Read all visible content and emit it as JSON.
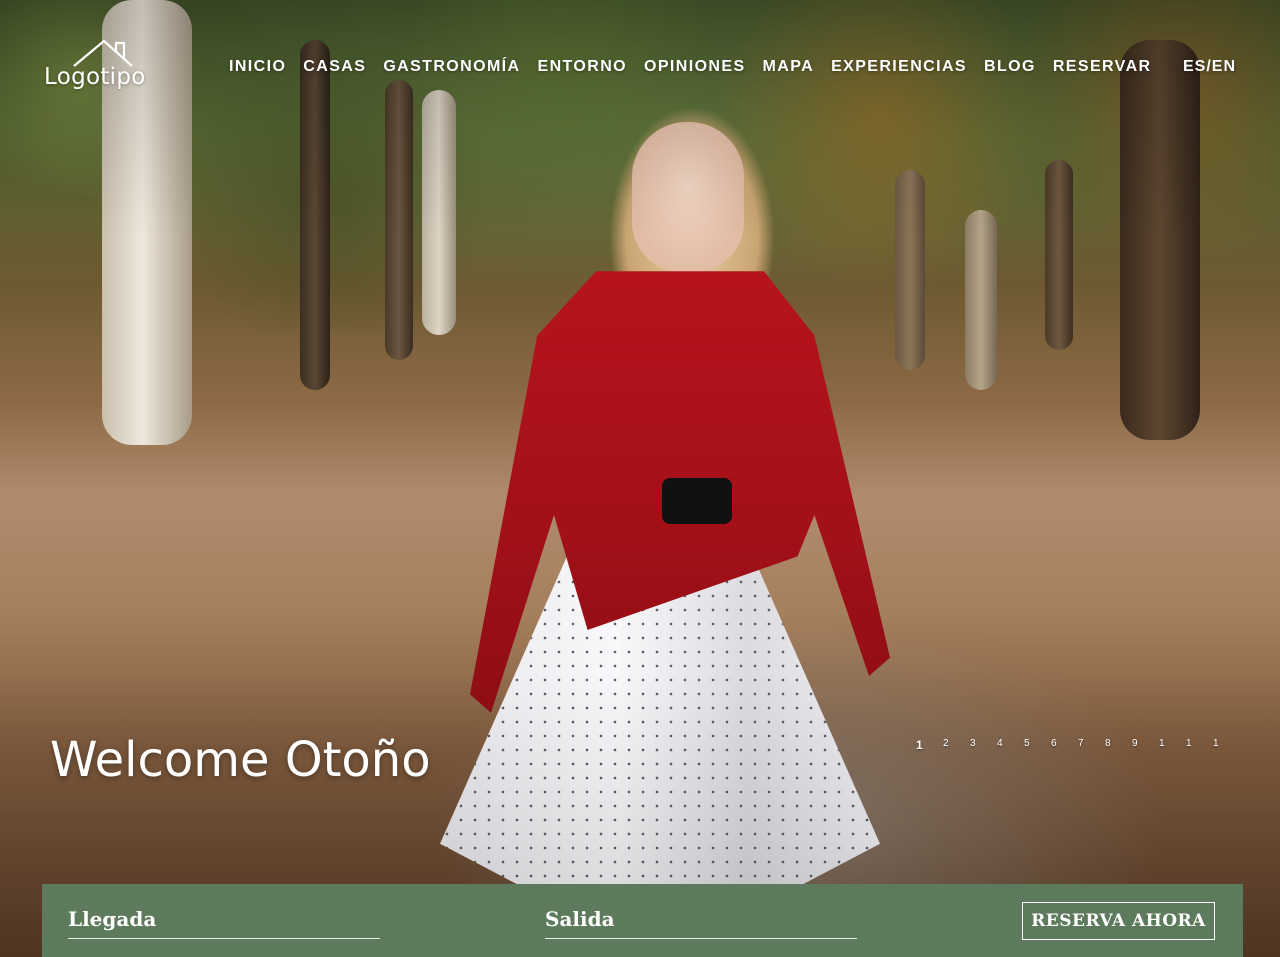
{
  "logo": {
    "text": "Logotipo",
    "icon": "house-roof-icon"
  },
  "nav": {
    "items": [
      "INICIO",
      "CASAS",
      "GASTRONOMÍA",
      "ENTORNO",
      "OPINIONES",
      "MAPA",
      "EXPERIENCIAS",
      "BLOG",
      "RESERVAR"
    ]
  },
  "lang": {
    "label": "ES/EN"
  },
  "hero": {
    "title": "Welcome Otoño",
    "slides": [
      "1",
      "2",
      "3",
      "4",
      "5",
      "6",
      "7",
      "8",
      "9",
      "1",
      "1",
      "1"
    ],
    "active_slide": 0
  },
  "booking": {
    "arrival_placeholder": "Llegada",
    "departure_placeholder": "Salida",
    "button_label": "RESERVA AHORA",
    "bar_color": "#5e7a5d"
  }
}
